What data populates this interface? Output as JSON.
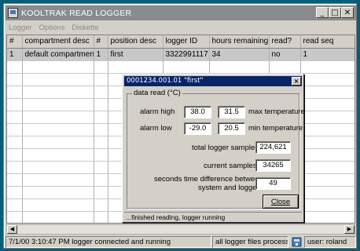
{
  "window": {
    "title": "KOOLTRAK READ LOGGER",
    "min": "_",
    "max": "□",
    "close": "✕"
  },
  "menu": [
    {
      "label": "Logger"
    },
    {
      "label": "Options"
    },
    {
      "label": "Diskette"
    }
  ],
  "table": {
    "columns": [
      "#",
      "compartment desc",
      "#",
      "position desc",
      "logger ID",
      "hours remaining",
      "read?",
      "read seq"
    ],
    "rows": [
      [
        "1",
        "default compartment",
        "1",
        "first",
        "3322991117",
        "34",
        "no",
        "1"
      ]
    ],
    "empty_rows": 14
  },
  "dialog": {
    "title": "0001234.001.01 \"first\"",
    "close": "×",
    "group_label": "data read (°C)",
    "alarm_high_label": "alarm high",
    "alarm_high_value": "38.0",
    "max_temp_value": "31.5",
    "max_temp_label": "max temperature",
    "alarm_low_label": "alarm low",
    "alarm_low_value": "-29.0",
    "min_temp_value": "20.5",
    "min_temp_label": "min temperature",
    "total_samples_label": "total logger samples",
    "total_samples_value": "224,621",
    "current_samples_label": "current samples",
    "current_samples_value": "34265",
    "time_diff_label_1": "seconds time difference between",
    "time_diff_label_2": "system and logger",
    "time_diff_value": "49",
    "close_button": "Close",
    "status": "...finished reading, logger running"
  },
  "statusbar": {
    "message": "7/1/00 3:10:47 PM logger connected and running",
    "files": "all logger files processed",
    "user": "user: roland"
  }
}
